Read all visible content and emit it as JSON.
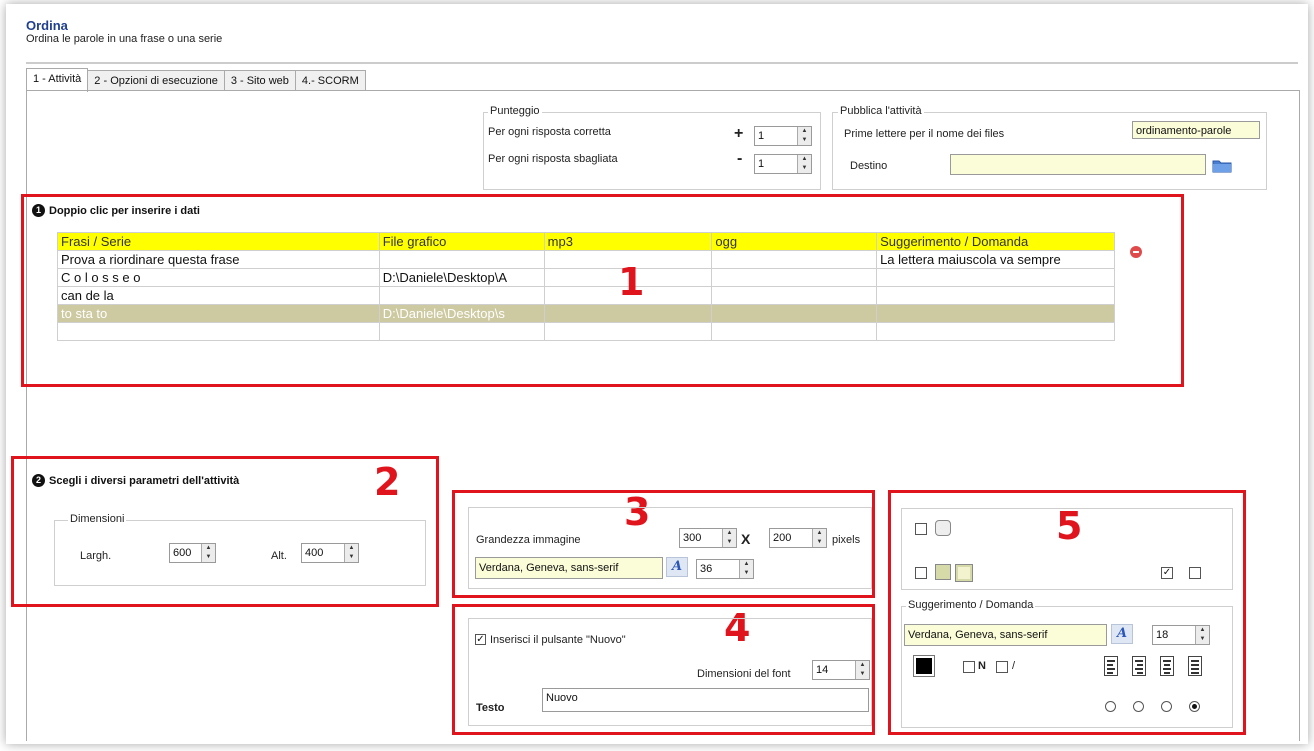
{
  "header": {
    "title": "Ordina",
    "subtitle": "Ordina le parole in una frase o una serie"
  },
  "tabs": [
    {
      "label": "1 - Attività",
      "active": true
    },
    {
      "label": "2 - Opzioni di esecuzione"
    },
    {
      "label": "3 - Sito web"
    },
    {
      "label": "4.- SCORM"
    }
  ],
  "punteggio": {
    "title": "Punteggio",
    "correct_label": "Per ogni risposta corretta",
    "correct_sign": "+",
    "correct_value": "1",
    "wrong_label": "Per ogni risposta sbagliata",
    "wrong_sign": "-",
    "wrong_value": "1"
  },
  "pubblica": {
    "title": "Pubblica l'attività",
    "prefix_label": "Prime lettere per il nome dei files",
    "prefix_value": "ordinamento-parole",
    "dest_label": "Destino",
    "dest_value": ""
  },
  "section1": {
    "title": "Doppio clic per inserire i dati",
    "number": "1"
  },
  "grid": {
    "headers": [
      "Frasi / Serie",
      "File grafico",
      "mp3",
      "ogg",
      "Suggerimento / Domanda"
    ],
    "rows": [
      [
        "Prova a riordinare questa frase",
        "",
        "",
        "",
        "La lettera maiuscola va sempre"
      ],
      [
        "C o l o s s e o",
        "D:\\Daniele\\Desktop\\A",
        "",
        "",
        ""
      ],
      [
        "can de la",
        "",
        "",
        "",
        ""
      ],
      [
        "to sta to",
        "D:\\Daniele\\Desktop\\s",
        "",
        "",
        ""
      ],
      [
        "",
        "",
        "",
        "",
        ""
      ]
    ]
  },
  "section2": {
    "title": "Scegli i diversi parametri dell'attività",
    "number": "2"
  },
  "dimensioni": {
    "title": "Dimensioni",
    "width_label": "Largh.",
    "width_value": "600",
    "height_label": "Alt.",
    "height_value": "400"
  },
  "section3": {
    "number": "3",
    "size_label": "Grandezza immagine",
    "w": "300",
    "x": "X",
    "h": "200",
    "unit": "pixels",
    "font": "Verdana, Geneva, sans-serif",
    "font_size": "36"
  },
  "section4": {
    "number": "4",
    "checkbox_label": "Inserisci il pulsante \"Nuovo\"",
    "checked": true,
    "font_size_label": "Dimensioni del font",
    "font_size": "14",
    "text_label": "Testo",
    "text_value": "Nuovo"
  },
  "section5": {
    "number": "5",
    "group_title": "Suggerimento / Domanda",
    "font": "Verdana, Geneva, sans-serif",
    "font_size": "18",
    "bold_label": "N",
    "italic_label": "/"
  },
  "colors": {
    "accent_red": "#e0141c",
    "header_yellow": "#ffff00",
    "selected_row": "#cdc9a1"
  },
  "icons": [
    "delete-icon",
    "folder-icon",
    "font-icon",
    "align-left-icon",
    "align-right-icon",
    "align-center-icon",
    "align-justify-icon"
  ]
}
